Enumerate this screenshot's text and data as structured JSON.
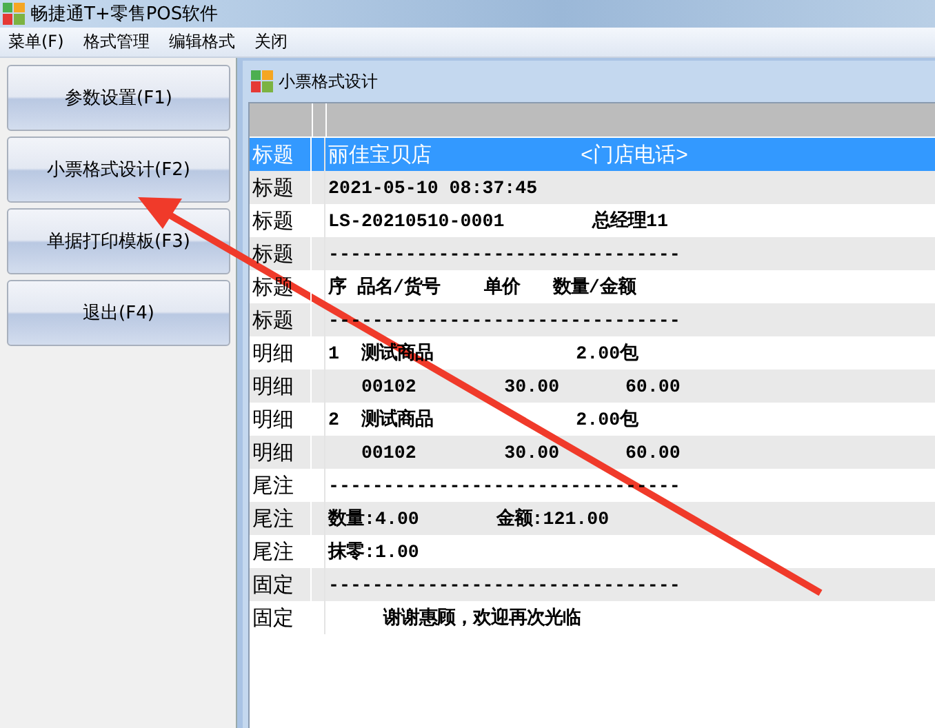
{
  "window": {
    "title": "畅捷通T+零售POS软件"
  },
  "menu": [
    "菜单(F)",
    "格式管理",
    "编辑格式",
    "关闭"
  ],
  "side_buttons": [
    {
      "label": "参数设置(F1)"
    },
    {
      "label": "小票格式设计(F2)"
    },
    {
      "label": "单据打印模板(F3)"
    },
    {
      "label": "退出(F4)"
    }
  ],
  "child_window": {
    "title": "小票格式设计"
  },
  "rows": [
    {
      "section": "标题",
      "content": "丽佳宝贝店            <门店电话>",
      "selected": true
    },
    {
      "section": "标题",
      "content": "2021-05-10 08:37:45",
      "selected": false
    },
    {
      "section": "标题",
      "content": "LS-20210510-0001        总经理11",
      "selected": false
    },
    {
      "section": "标题",
      "content": "--------------------------------",
      "selected": false
    },
    {
      "section": "标题",
      "content": "序 品名/货号    单价   数量/金额",
      "selected": false
    },
    {
      "section": "标题",
      "content": "--------------------------------",
      "selected": false
    },
    {
      "section": "明细",
      "content": "1  测试商品             2.00包",
      "selected": false
    },
    {
      "section": "明细",
      "content": "   00102        30.00      60.00",
      "selected": false
    },
    {
      "section": "明细",
      "content": "2  测试商品             2.00包",
      "selected": false
    },
    {
      "section": "明细",
      "content": "   00102        30.00      60.00",
      "selected": false
    },
    {
      "section": "尾注",
      "content": "--------------------------------",
      "selected": false
    },
    {
      "section": "尾注",
      "content": "数量:4.00       金额:121.00",
      "selected": false
    },
    {
      "section": "尾注",
      "content": "抹零:1.00",
      "selected": false
    },
    {
      "section": "固定",
      "content": "--------------------------------",
      "selected": false
    },
    {
      "section": "固定",
      "content": "     谢谢惠顾，欢迎再次光临",
      "selected": false
    }
  ]
}
